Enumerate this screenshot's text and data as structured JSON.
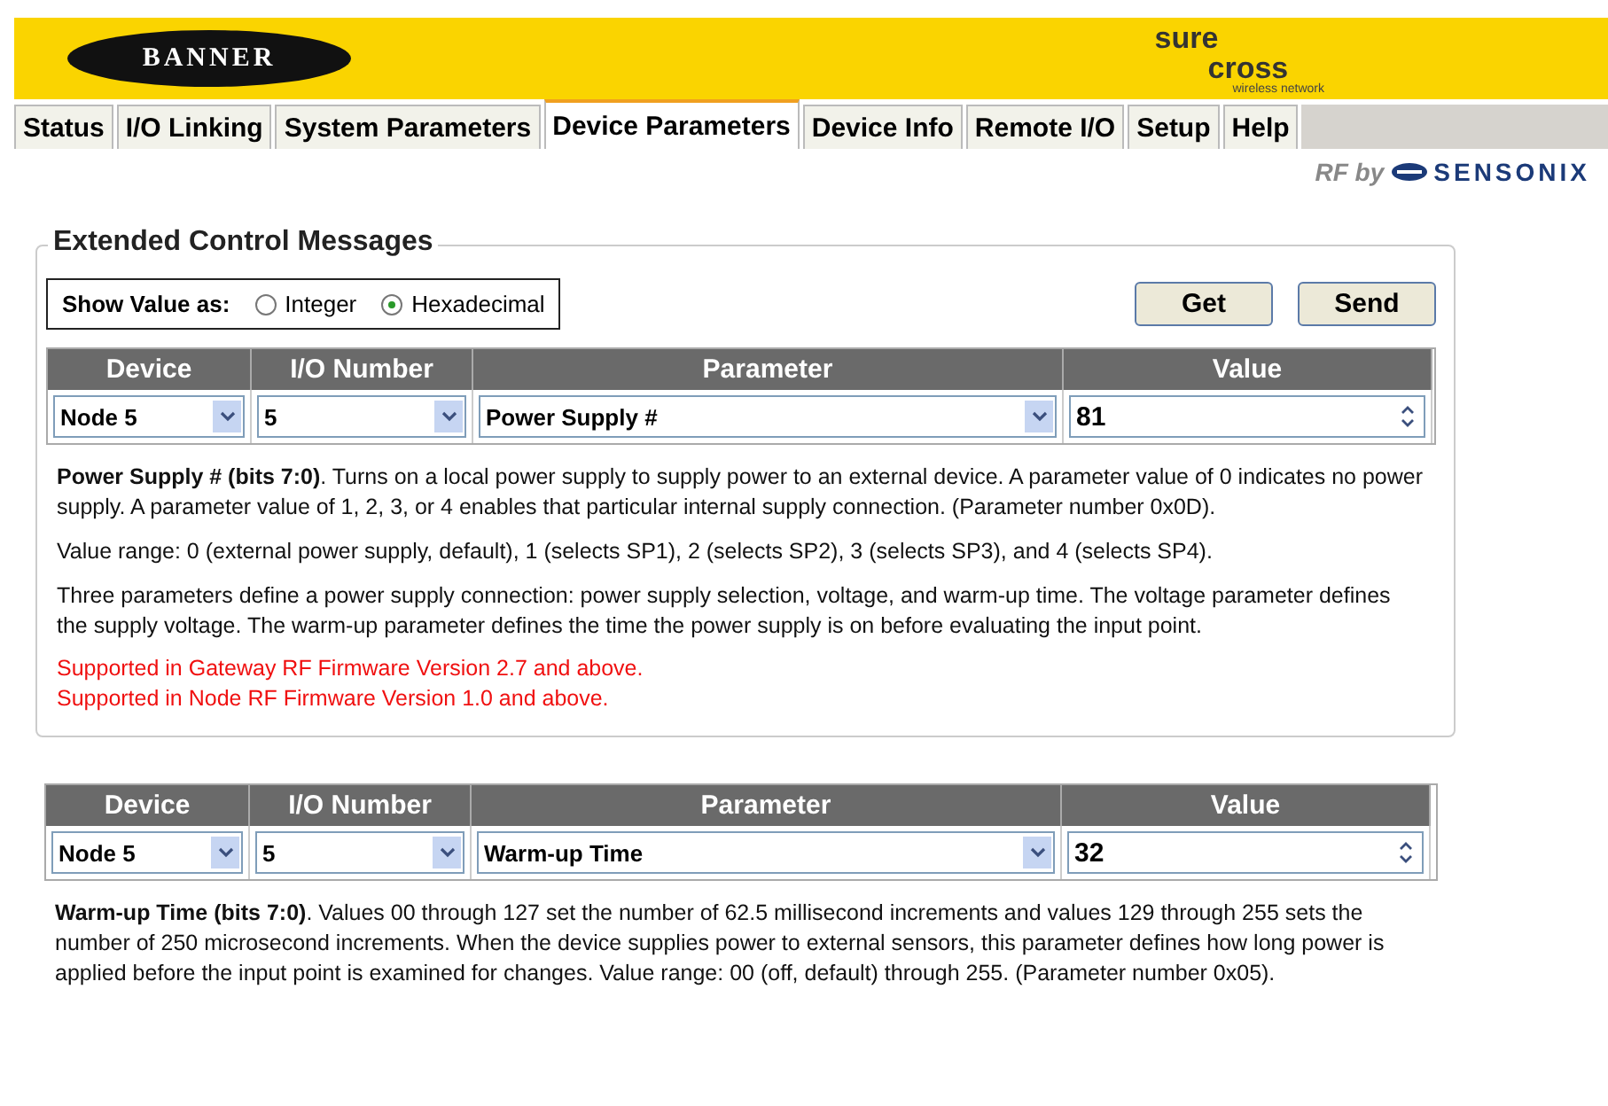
{
  "header": {
    "brand": "BANNER",
    "product_top": "sure",
    "product_bottom": "cross",
    "product_tagline": "wireless network"
  },
  "tabs": [
    {
      "label": "Status",
      "selected": false
    },
    {
      "label": "I/O Linking",
      "selected": false
    },
    {
      "label": "System Parameters",
      "selected": false
    },
    {
      "label": "Device Parameters",
      "selected": true
    },
    {
      "label": "Device Info",
      "selected": false
    },
    {
      "label": "Remote I/O",
      "selected": false
    },
    {
      "label": "Setup",
      "selected": false
    },
    {
      "label": "Help",
      "selected": false
    }
  ],
  "credit": {
    "prefix": "RF by",
    "name": "SENSONIX"
  },
  "panel": {
    "title": "Extended Control Messages",
    "show_value": {
      "label": "Show Value as:",
      "options": [
        {
          "label": "Integer",
          "selected": false
        },
        {
          "label": "Hexadecimal",
          "selected": true
        }
      ]
    },
    "buttons": [
      "Get",
      "Send"
    ],
    "columns": [
      "Device",
      "I/O Number",
      "Parameter",
      "Value"
    ],
    "row": {
      "device": "Node 5",
      "io_number": "5",
      "parameter": "Power Supply #",
      "value": "81"
    },
    "description": [
      {
        "kind": "text",
        "text": "**Power Supply # (bits 7:0)**. Turns on a local power supply to supply power to an external device. A parameter value of 0 indicates no power supply. A parameter value of 1, 2, 3, or 4 enables that particular internal supply connection. (Parameter number 0x0D)."
      },
      {
        "kind": "text",
        "text": "Value range: 0 (external power supply, default), 1 (selects SP1), 2 (selects SP2), 3 (selects SP3), and 4 (selects SP4)."
      },
      {
        "kind": "text",
        "text": "Three parameters define a power supply connection: power supply selection, voltage, and warm-up time. The voltage parameter defines the supply voltage. The warm-up parameter defines the time the power supply is on before evaluating the input point."
      },
      {
        "kind": "note",
        "text": "Supported in Gateway RF Firmware Version 2.7 and above."
      },
      {
        "kind": "note",
        "text": "Supported in Node RF Firmware Version 1.0 and above."
      }
    ]
  },
  "panel_2": {
    "columns": [
      "Device",
      "I/O Number",
      "Parameter",
      "Value"
    ],
    "row": {
      "device": "Node 5",
      "io_number": "5",
      "parameter": "Warm-up Time",
      "value": "32"
    },
    "description": [
      {
        "kind": "text",
        "text": "**Warm-up Time (bits 7:0)**. Values 00 through 127 set the number of 62.5 millisecond increments and values 129 through 255 sets the number of 250 microsecond increments. When the device supplies power to external sensors, this parameter defines how long power is applied before the input point is examined for changes. Value range: 00 (off, default) through 255. (Parameter number 0x05)."
      }
    ]
  }
}
